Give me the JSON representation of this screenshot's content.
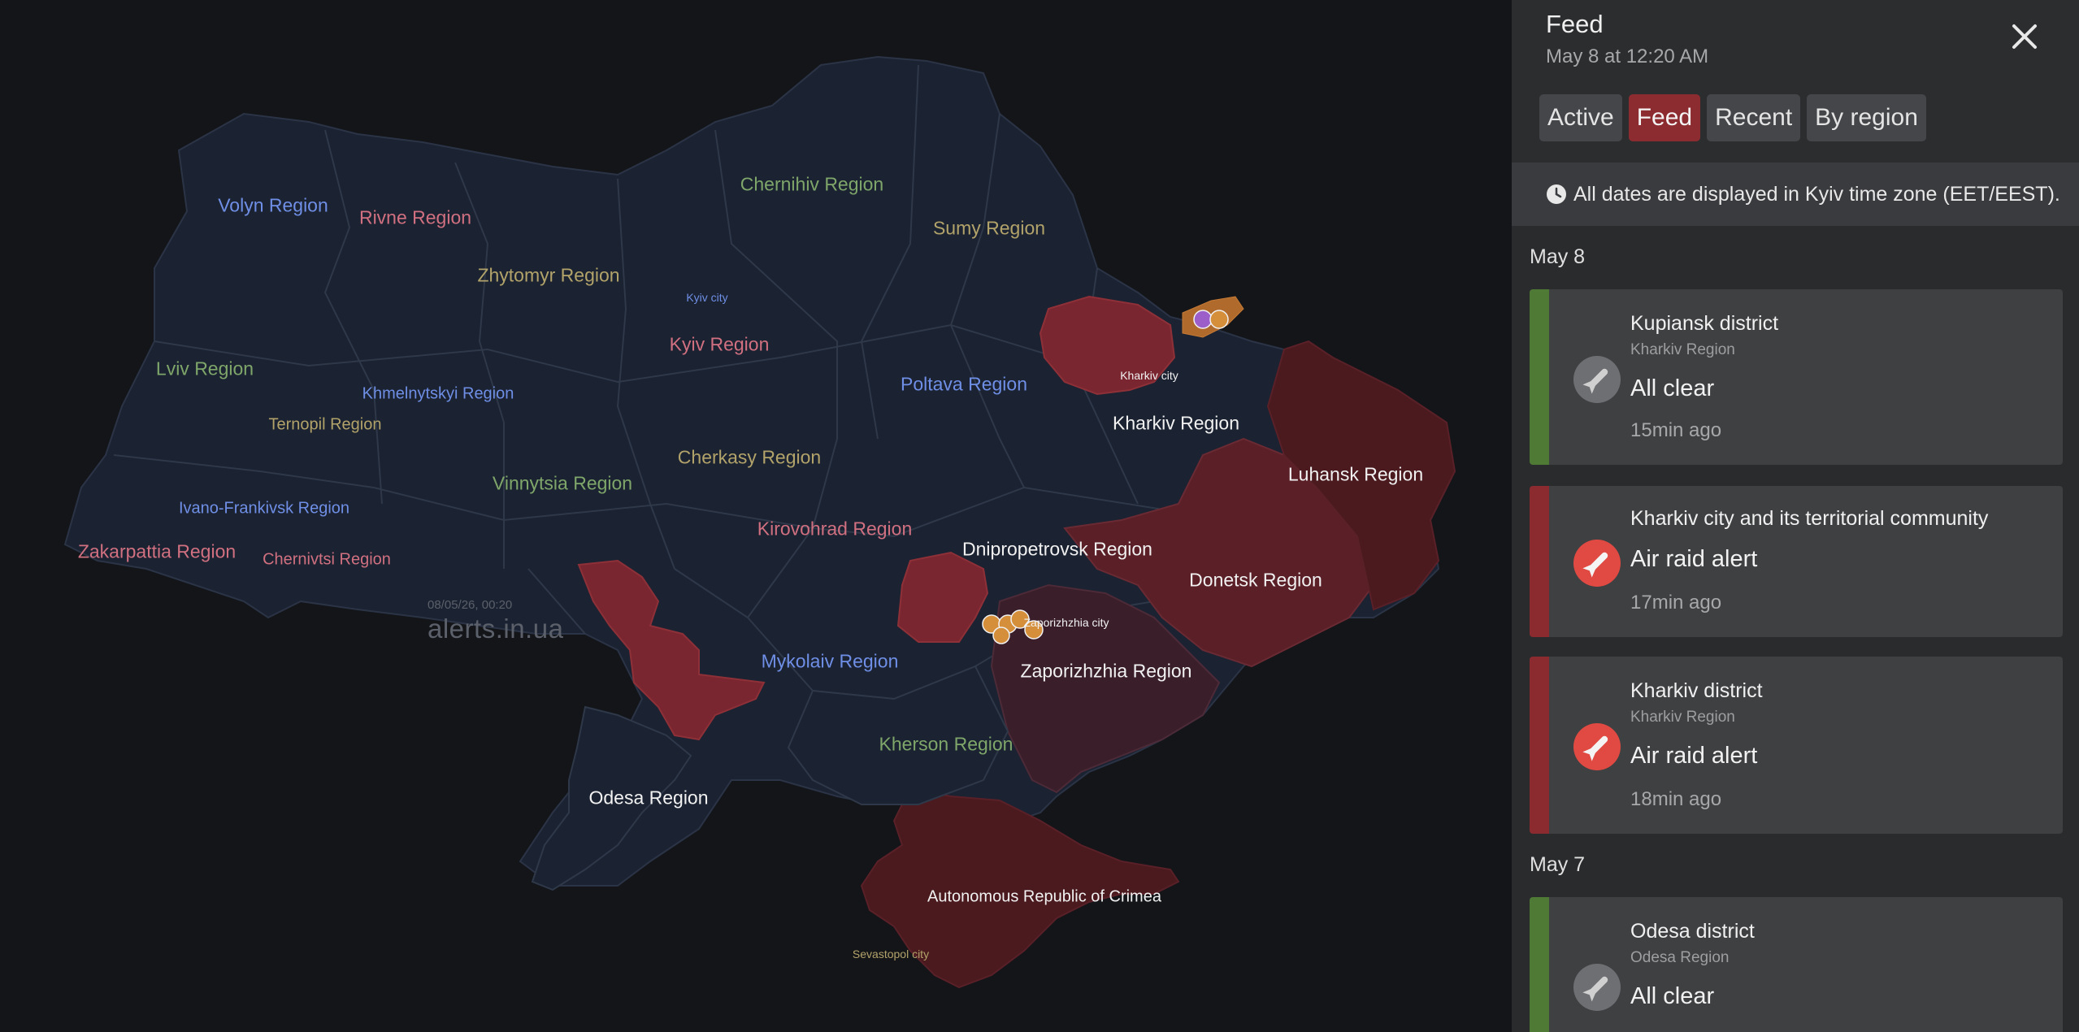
{
  "map": {
    "watermark_date": "08/05/26, 00:20",
    "watermark_site": "alerts.in.ua",
    "regions": {
      "volyn": "Volyn Region",
      "rivne": "Rivne Region",
      "zhytomyr": "Zhytomyr Region",
      "chernihiv": "Chernihiv Region",
      "sumy": "Sumy Region",
      "kyiv_city": "Kyiv city",
      "kyiv": "Kyiv Region",
      "lviv": "Lviv Region",
      "khmelnytskyi": "Khmelnytskyi Region",
      "ternopil": "Ternopil Region",
      "poltava": "Poltava Region",
      "kharkiv_city": "Kharkiv city",
      "kharkiv": "Kharkiv Region",
      "luhansk": "Luhansk Region",
      "cherkasy": "Cherkasy Region",
      "vinnytsia": "Vinnytsia Region",
      "ivano_frankivsk": "Ivano-Frankivsk Region",
      "zakarpattia": "Zakarpattia Region",
      "chernivtsi": "Chernivtsi Region",
      "kirovohrad": "Kirovohrad Region",
      "dnipropetrovsk": "Dnipropetrovsk Region",
      "donetsk": "Donetsk Region",
      "zaporizhzhia_city": "Zaporizhzhia city",
      "mykolaiv": "Mykolaiv Region",
      "zaporizhzhia": "Zaporizhzhia Region",
      "kherson": "Kherson Region",
      "odesa": "Odesa Region",
      "crimea": "Autonomous Republic of Crimea",
      "sevastopol": "Sevastopol city"
    }
  },
  "sidebar": {
    "title": "Feed",
    "timestamp": "May 8 at 12:20 AM",
    "tabs": [
      {
        "label": "Active",
        "active": false
      },
      {
        "label": "Feed",
        "active": true
      },
      {
        "label": "Recent",
        "active": false
      },
      {
        "label": "By region",
        "active": false
      }
    ],
    "timezone_notice": "All dates are displayed in Kyiv time zone (EET/EEST).",
    "days": [
      {
        "label": "May 8",
        "events": [
          {
            "district": "Kupiansk district",
            "region": "Kharkiv Region",
            "status": "All clear",
            "ago": "15min ago",
            "kind": "clear",
            "icon": "missile-icon"
          },
          {
            "district": "Kharkiv city and its territorial community",
            "region": "",
            "status": "Air raid alert",
            "ago": "17min ago",
            "kind": "alert",
            "icon": "missile-icon"
          },
          {
            "district": "Kharkiv district",
            "region": "Kharkiv Region",
            "status": "Air raid alert",
            "ago": "18min ago",
            "kind": "alert",
            "icon": "missile-icon"
          }
        ]
      },
      {
        "label": "May 7",
        "events": [
          {
            "district": "Odesa district",
            "region": "Odesa Region",
            "status": "All clear",
            "ago": "",
            "kind": "clear",
            "icon": "missile-icon"
          }
        ]
      }
    ]
  },
  "colors": {
    "alert": "#8b2a2f",
    "clear": "#4f7a35",
    "tab_active": "#8c2c31",
    "region_base": "#1b2231",
    "occupied": "#4a1a1f"
  }
}
